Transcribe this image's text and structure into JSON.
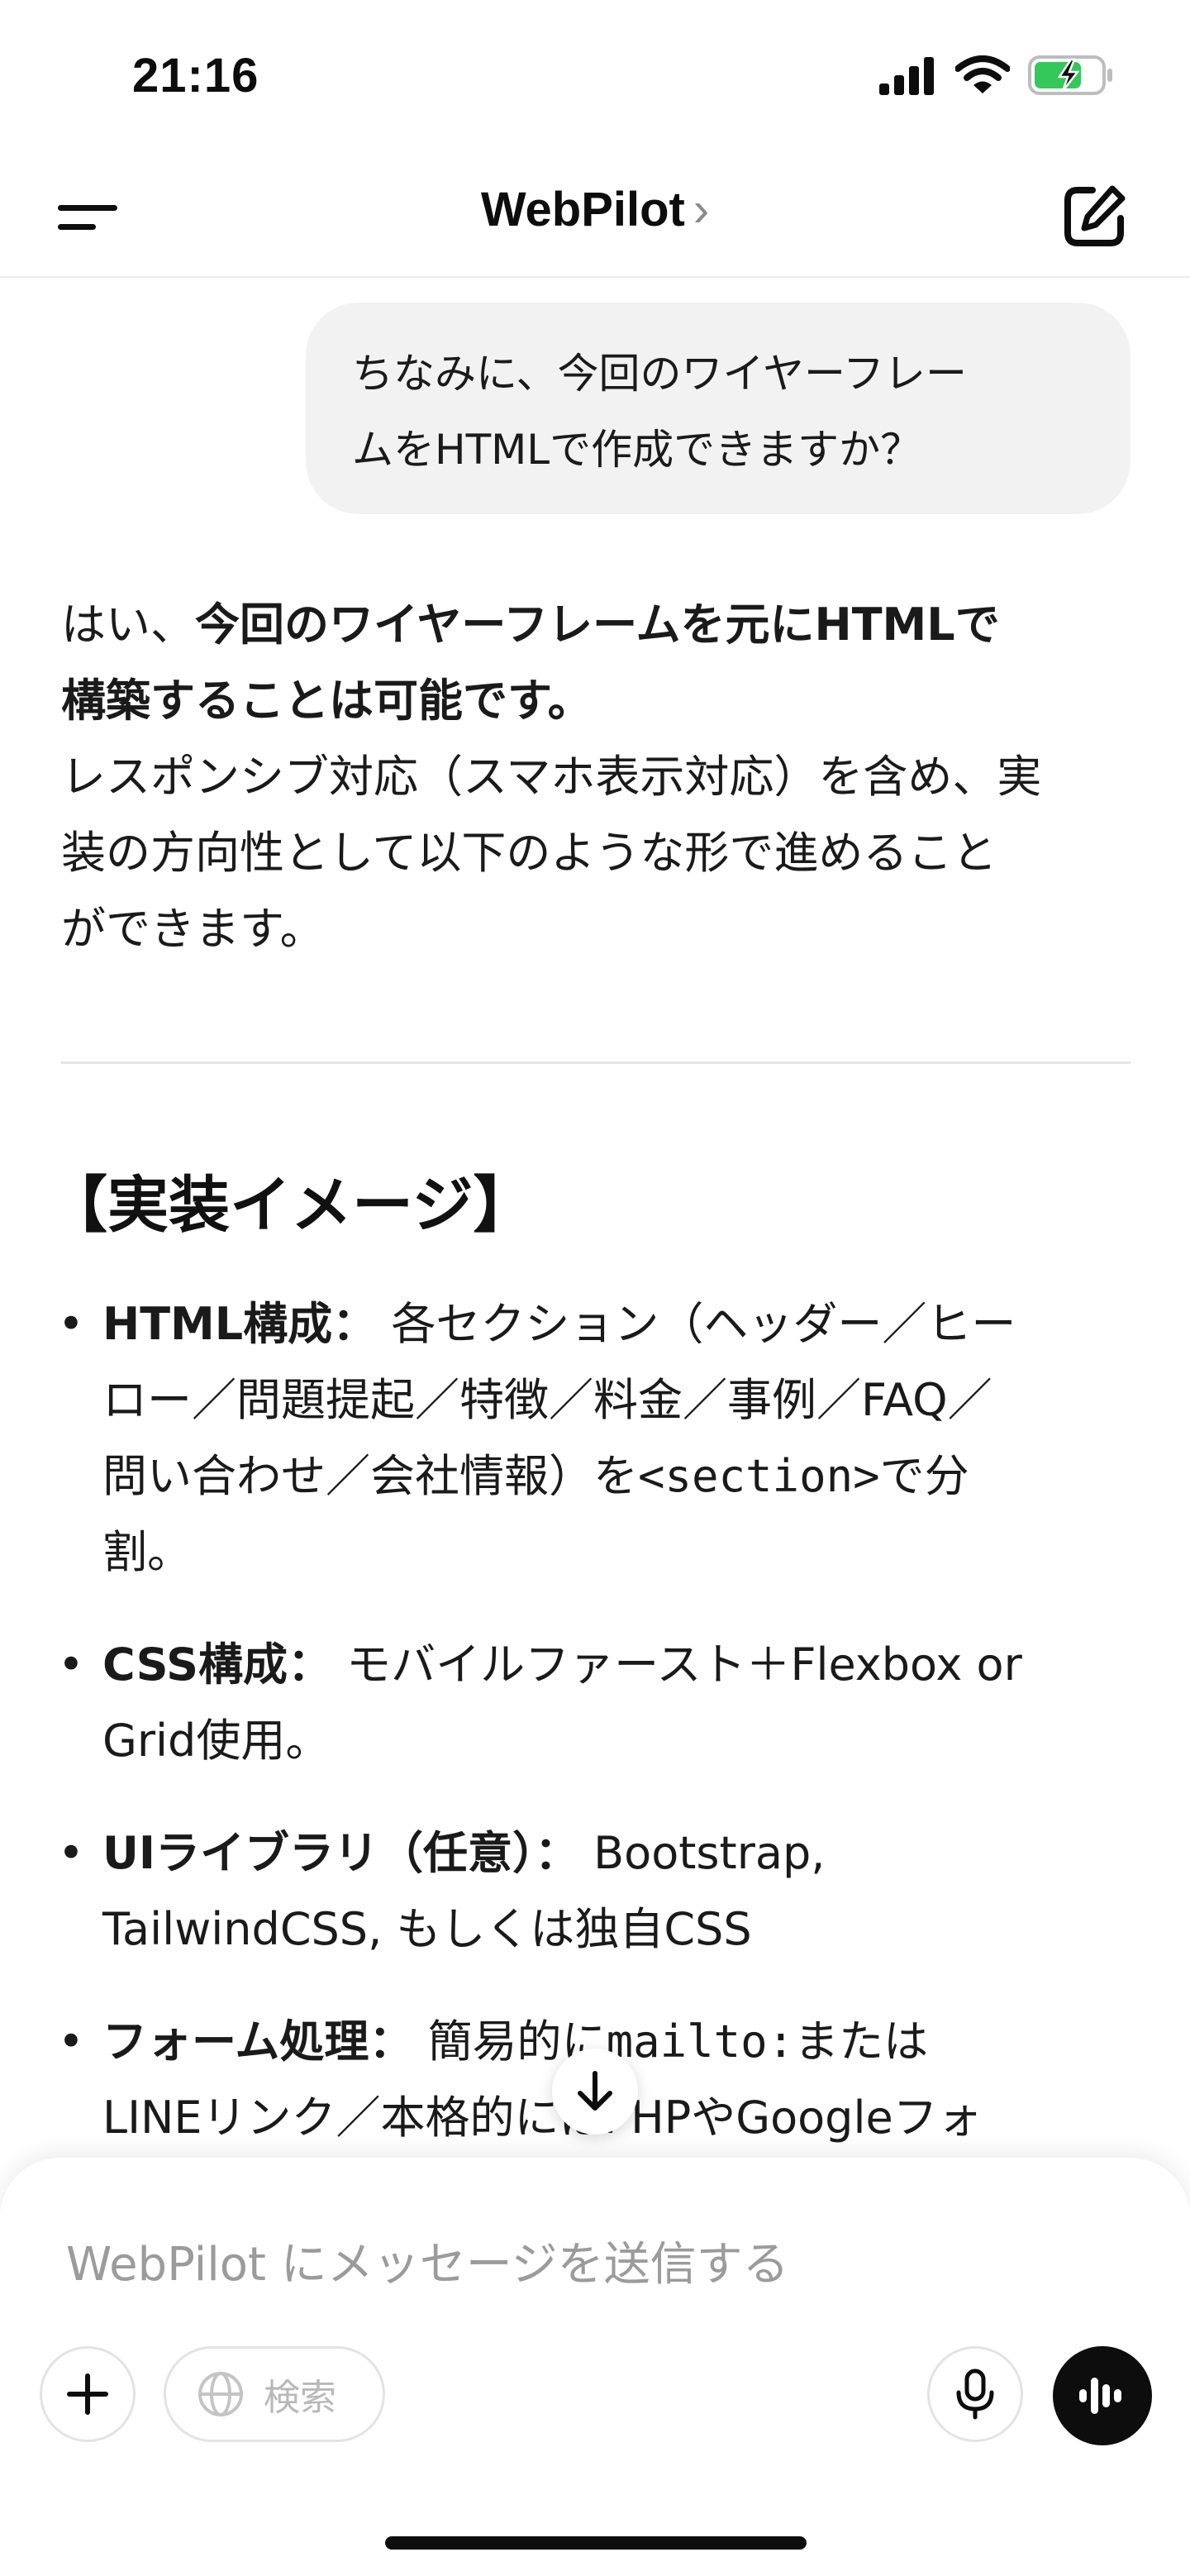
{
  "status_bar": {
    "time": "21:16",
    "icons": [
      "cellular-signal-icon",
      "wifi-icon",
      "battery-charging-icon"
    ],
    "battery_color": "#34c759"
  },
  "nav": {
    "title": "WebPilot",
    "chevron": "›",
    "icons": [
      "menu-icon",
      "compose-icon"
    ]
  },
  "conversation": {
    "user_message": {
      "line1": "ちなみに、今回のワイヤーフレー",
      "line2": "ムをHTMLで作成できますか？"
    },
    "assistant_intro": {
      "lead": "はい、",
      "bold_line1": "今回のワイヤーフレームを元にHTMLで",
      "bold_line2": "構築することは可能です。",
      "line3": "レスポンシブ対応（スマホ表示対応）を含め、実",
      "line4": "装の方向性として以下のような形で進めること",
      "line5": "ができます。"
    },
    "section_heading": "【実装イメージ】",
    "bullets": [
      {
        "label": "HTML構成：",
        "line1": "各セクション（ヘッダー／ヒー",
        "line2": "ロー／問題提起／特徴／料金／事例／FAQ／",
        "line3_pre": "問い合わせ／会社情報）を",
        "line3_code": "<section>",
        "line3_post": "で分",
        "line4": "割。"
      },
      {
        "label": "CSS構成：",
        "line1": "モバイルファースト＋Flexbox or",
        "line2": "Grid使用。"
      },
      {
        "label": "UIライブラリ（任意）：",
        "line1": "Bootstrap,",
        "line2": "TailwindCSS, もしくは独自CSS"
      },
      {
        "label": "フォーム処理：",
        "line1_pre": "簡易的に",
        "line1_code": "mailto:",
        "line1_post": "または",
        "line2": "LINEリンク／本格的にはPHPやGoogleフォ"
      }
    ],
    "bullet_glyph": "•"
  },
  "composer": {
    "placeholder": "WebPilot にメッセージを送信する",
    "search_label": "検索",
    "icons": [
      "plus-icon",
      "globe-icon",
      "microphone-icon",
      "voice-mode-icon",
      "arrow-down-icon"
    ]
  }
}
